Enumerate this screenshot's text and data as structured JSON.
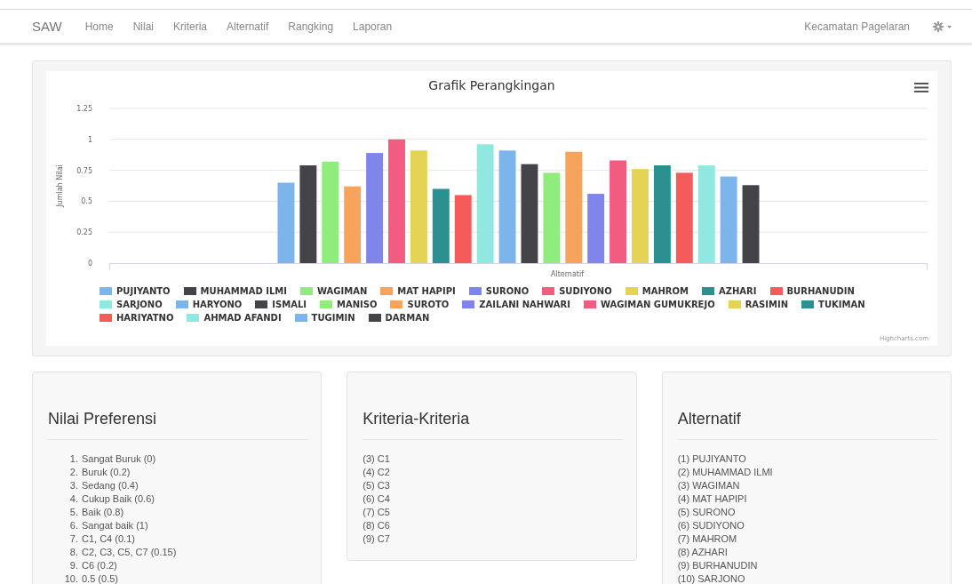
{
  "navbar": {
    "brand": "SAW",
    "links": [
      "Home",
      "Nilai",
      "Kriteria",
      "Alternatif",
      "Rangking",
      "Laporan"
    ],
    "user": "Kecamatan Pagelaran"
  },
  "chart_panel": {
    "credits": "Highcharts.com",
    "chart_data": {
      "type": "bar",
      "orientation": "vertical",
      "title": "Grafik Perangkingan",
      "xlabel": "Alternatif",
      "ylabel": "Jumlah Nilai",
      "grid": true,
      "legend": "bottom",
      "ylim": [
        0,
        1.25
      ],
      "yticks": [
        0,
        0.25,
        0.5,
        0.75,
        1,
        1.25
      ],
      "series": [
        {
          "name": "PUJIYANTO",
          "color": "#7cb5ec",
          "values": [
            0.65
          ]
        },
        {
          "name": "MUHAMMAD ILMI",
          "color": "#434348",
          "values": [
            0.79
          ]
        },
        {
          "name": "WAGIMAN",
          "color": "#90ed7d",
          "values": [
            0.82
          ]
        },
        {
          "name": "MAT HAPIPI",
          "color": "#f7a35c",
          "values": [
            0.62
          ]
        },
        {
          "name": "SURONO",
          "color": "#8085e9",
          "values": [
            0.89
          ]
        },
        {
          "name": "SUDIYONO",
          "color": "#f15c80",
          "values": [
            1
          ]
        },
        {
          "name": "MAHROM",
          "color": "#e4d354",
          "values": [
            0.91
          ]
        },
        {
          "name": "AZHARI",
          "color": "#2b908f",
          "values": [
            0.6
          ]
        },
        {
          "name": "BURHANUDIN",
          "color": "#f45b5b",
          "values": [
            0.55
          ]
        },
        {
          "name": "SARJONO",
          "color": "#91e8e1",
          "values": [
            0.96
          ]
        },
        {
          "name": "HARYONO",
          "color": "#7cb5ec",
          "values": [
            0.91
          ]
        },
        {
          "name": "ISMALI",
          "color": "#434348",
          "values": [
            0.8
          ]
        },
        {
          "name": "MANISO",
          "color": "#90ed7d",
          "values": [
            0.73
          ]
        },
        {
          "name": "SUROTO",
          "color": "#f7a35c",
          "values": [
            0.9
          ]
        },
        {
          "name": "ZAILANI NAHWARI",
          "color": "#8085e9",
          "values": [
            0.56
          ]
        },
        {
          "name": "WAGIMAN GUMUKREJO",
          "color": "#f15c80",
          "values": [
            0.83
          ]
        },
        {
          "name": "RASIMIN",
          "color": "#e4d354",
          "values": [
            0.76
          ]
        },
        {
          "name": "TUKIMAN",
          "color": "#2b908f",
          "values": [
            0.79
          ]
        },
        {
          "name": "HARIYATNO",
          "color": "#f45b5b",
          "values": [
            0.73
          ]
        },
        {
          "name": "AHMAD AFANDI",
          "color": "#91e8e1",
          "values": [
            0.79
          ]
        },
        {
          "name": "TUGIMIN",
          "color": "#7cb5ec",
          "values": [
            0.7
          ]
        },
        {
          "name": "DARMAN",
          "color": "#434348",
          "values": [
            0.63
          ]
        }
      ]
    }
  },
  "panels": [
    {
      "title": "Nilai Preferensi",
      "kind": "numbered",
      "items": [
        {
          "number": "1.",
          "text": "Sangat Buruk (0)"
        },
        {
          "number": "2.",
          "text": "Buruk (0.2)"
        },
        {
          "number": "3.",
          "text": "Sedang (0.4)"
        },
        {
          "number": "4.",
          "text": "Cukup Baik (0.6)"
        },
        {
          "number": "5.",
          "text": "Baik (0.8)"
        },
        {
          "number": "6.",
          "text": "Sangat baik (1)"
        },
        {
          "number": "7.",
          "text": "C1, C4 (0.1)"
        },
        {
          "number": "8.",
          "text": "C2, C3, C5, C7 (0.15)"
        },
        {
          "number": "9.",
          "text": "C6 (0.2)"
        },
        {
          "number": "10.",
          "text": "0.5 (0.5)"
        }
      ]
    },
    {
      "title": "Kriteria-Kriteria",
      "kind": "plain",
      "items": [
        {
          "text": "(3) C1"
        },
        {
          "text": "(4) C2"
        },
        {
          "text": "(5) C3"
        },
        {
          "text": "(6) C4"
        },
        {
          "text": "(7) C5"
        },
        {
          "text": "(8) C6"
        },
        {
          "text": "(9) C7"
        }
      ]
    },
    {
      "title": "Alternatif",
      "kind": "plain",
      "items": [
        {
          "text": "(1) PUJIYANTO"
        },
        {
          "text": "(2) MUHAMMAD ILMI"
        },
        {
          "text": "(3) WAGIMAN"
        },
        {
          "text": "(4) MAT HAPIPI"
        },
        {
          "text": "(5) SURONO"
        },
        {
          "text": "(6) SUDIYONO"
        },
        {
          "text": "(7) MAHROM"
        },
        {
          "text": "(8) AZHARI"
        },
        {
          "text": "(9) BURHANUDIN"
        },
        {
          "text": "(10) SARJONO"
        }
      ]
    }
  ]
}
